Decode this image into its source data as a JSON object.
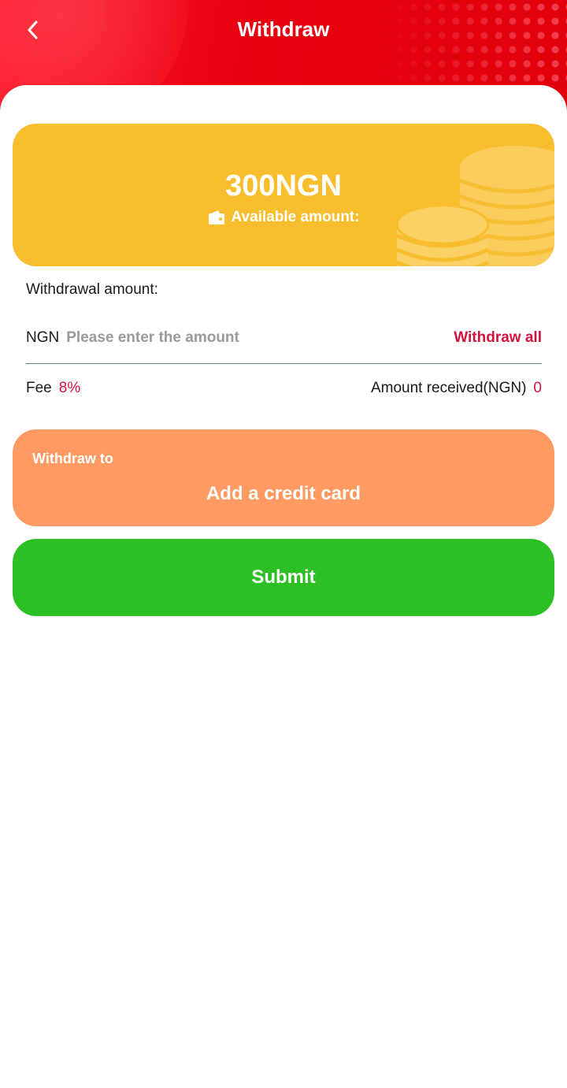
{
  "header": {
    "title": "Withdraw",
    "back_icon": "chevron-left-icon"
  },
  "balance": {
    "amount": "300NGN",
    "label": "Available amount:",
    "wallet_icon": "wallet-icon",
    "decoration_icon": "coins-icon"
  },
  "withdrawal": {
    "label": "Withdrawal amount:",
    "currency": "NGN",
    "input_value": "",
    "placeholder": "Please enter the amount",
    "withdraw_all_label": "Withdraw all"
  },
  "fee": {
    "label": "Fee",
    "value": "8%",
    "received_label": "Amount received(NGN)",
    "received_value": "0"
  },
  "withdraw_to": {
    "label": "Withdraw to",
    "card_label": "Add a credit card"
  },
  "submit": {
    "label": "Submit"
  },
  "colors": {
    "header_red": "#e8000f",
    "balance_yellow": "#f9be2e",
    "withdraw_to_orange": "#ff9a62",
    "submit_green": "#2cc025",
    "accent_red": "#d4123e"
  }
}
